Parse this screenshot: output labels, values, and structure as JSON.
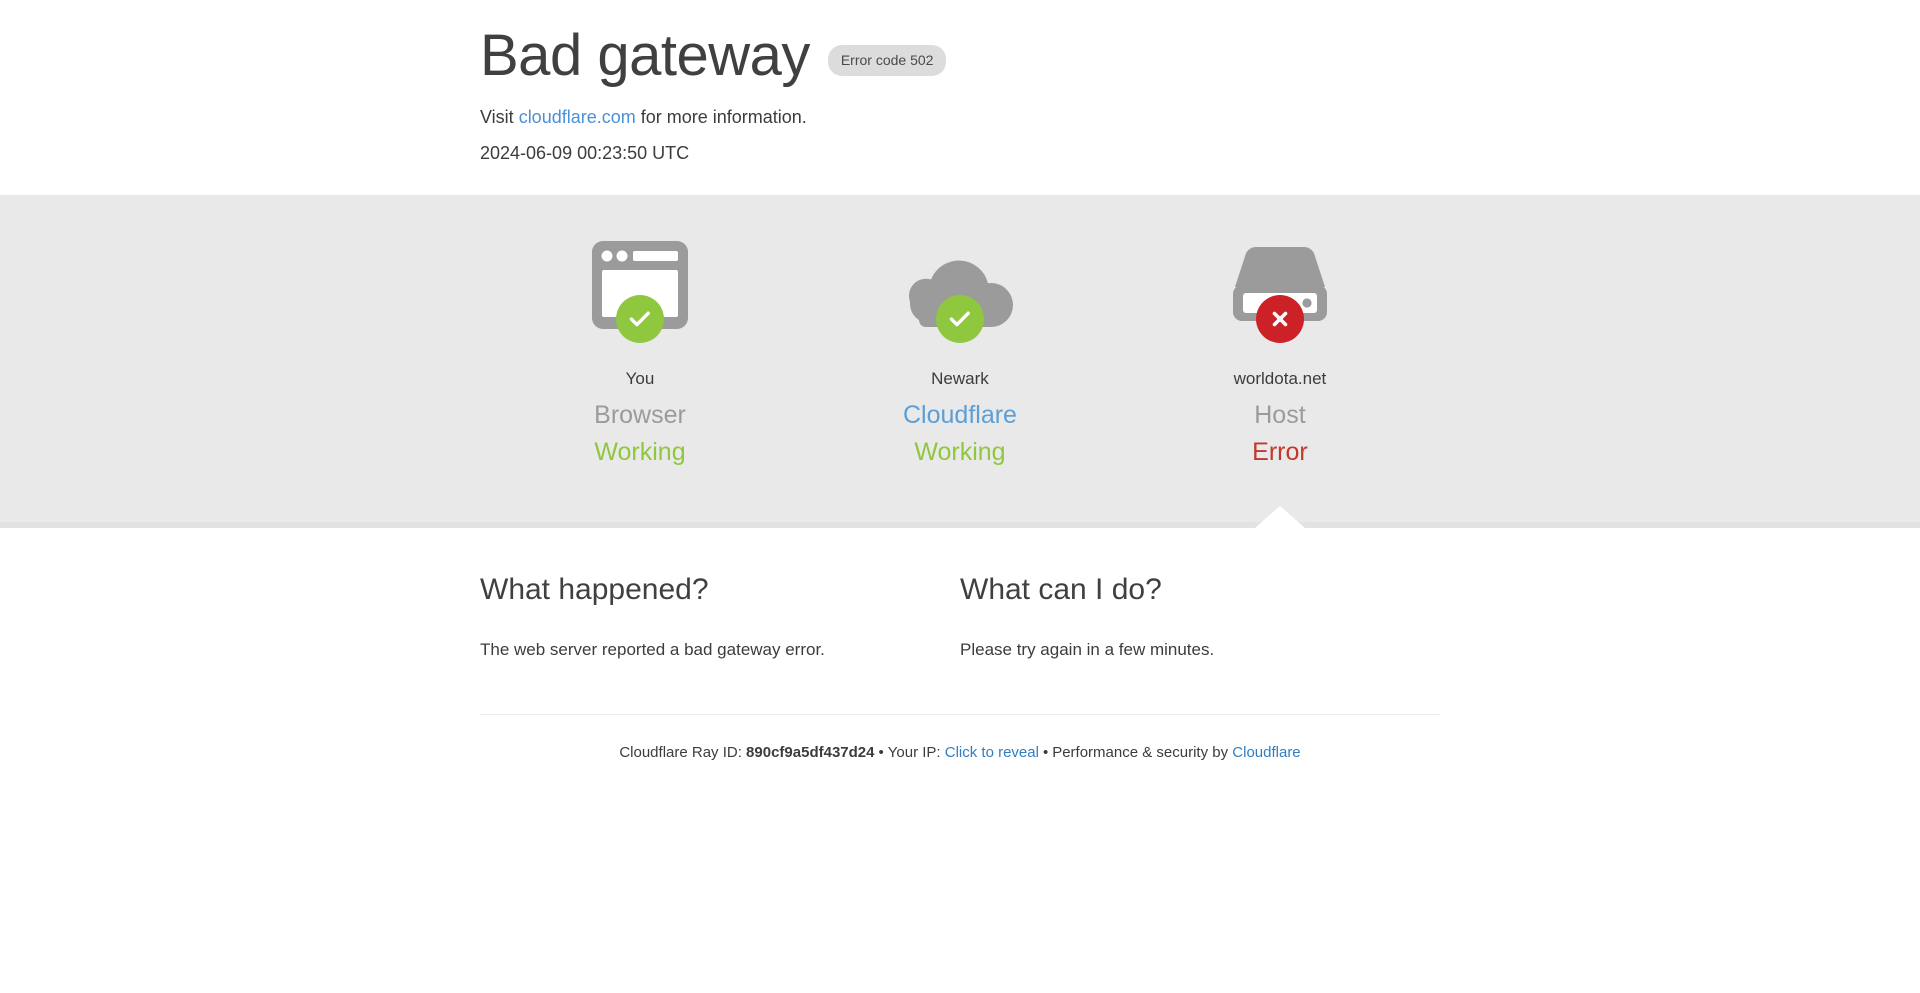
{
  "header": {
    "title": "Bad gateway",
    "error_code_badge": "Error code 502",
    "visit_prefix": "Visit ",
    "visit_link": "cloudflare.com",
    "visit_suffix": " for more information.",
    "timestamp": "2024-06-09 00:23:50 UTC"
  },
  "status": {
    "columns": [
      {
        "name": "You",
        "role": "Browser",
        "state": "Working",
        "state_kind": "ok",
        "icon": "browser-window-icon",
        "badge": "check-icon"
      },
      {
        "name": "Newark",
        "role": "Cloudflare",
        "state": "Working",
        "state_kind": "ok",
        "icon": "cloud-icon",
        "badge": "check-icon"
      },
      {
        "name": "worldota.net",
        "role": "Host",
        "state": "Error",
        "state_kind": "error",
        "icon": "server-icon",
        "badge": "cross-icon"
      }
    ]
  },
  "explain": {
    "what_happened": {
      "heading": "What happened?",
      "body": "The web server reported a bad gateway error."
    },
    "what_can_i_do": {
      "heading": "What can I do?",
      "body": "Please try again in a few minutes."
    }
  },
  "footer": {
    "ray_id_label": "Cloudflare Ray ID: ",
    "ray_id": "890cf9a5df437d24",
    "bullet_1": "•",
    "your_ip_label": "Your IP: ",
    "click_to_reveal": "Click to reveal",
    "bullet_2": "•",
    "performance_label": "Performance & security by ",
    "cloudflare_link": "Cloudflare"
  },
  "colors": {
    "green": "#8fc73e",
    "red": "#cc2127",
    "blue_link": "#4a90d9",
    "footer_link": "#2f7ec4",
    "band_bg": "#e9e9e9",
    "icon_grey": "#9b9b9b",
    "badge_bg": "#dcdcdc",
    "text": "#3c3c3c",
    "heading": "#404040",
    "role_grey": "#9b9b9b",
    "error_text": "#c0392b"
  }
}
